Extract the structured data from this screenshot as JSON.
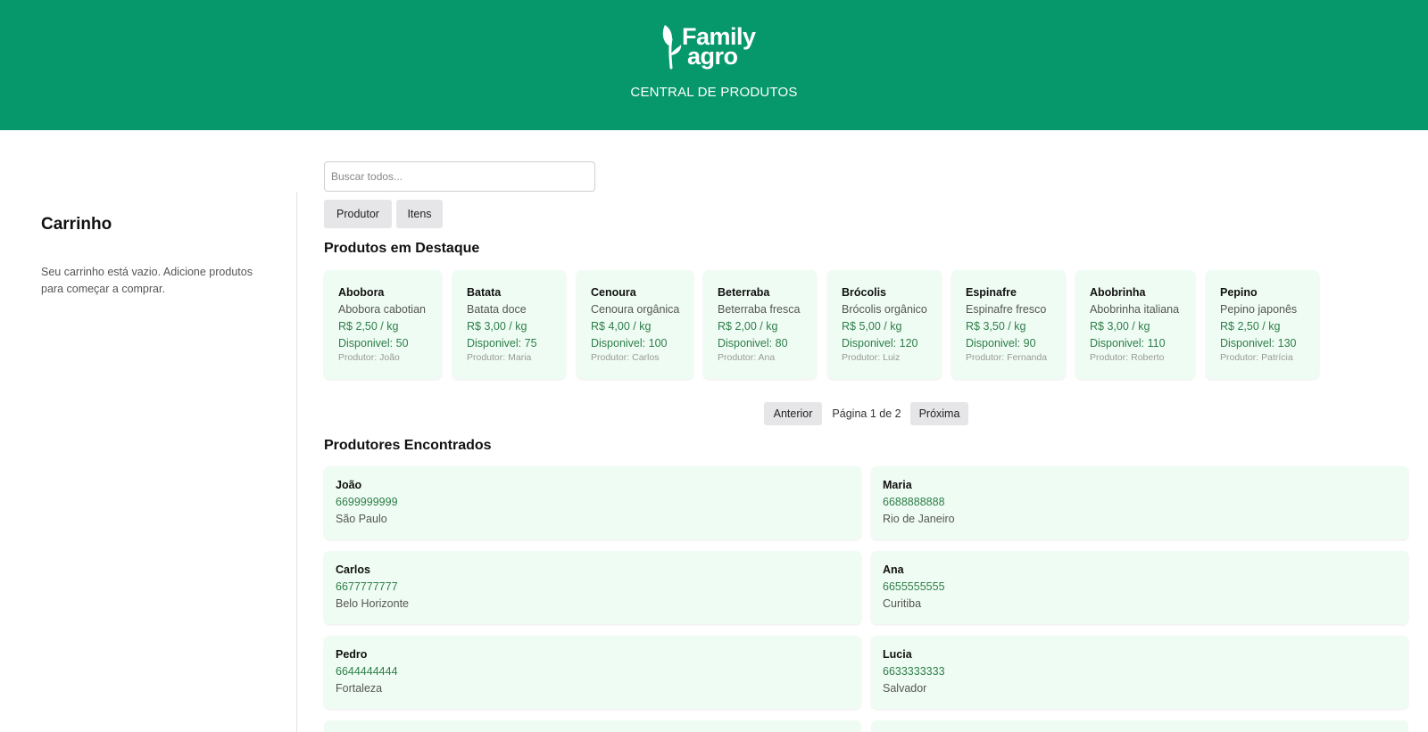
{
  "header": {
    "logo_line1": "Family",
    "logo_line2": "agro",
    "subtitle": "CENTRAL DE PRODUTOS",
    "brand_color": "#06986a"
  },
  "cart": {
    "title": "Carrinho",
    "empty_message": "Seu carrinho está vazio. Adicione produtos para começar a comprar."
  },
  "search": {
    "placeholder": "Buscar todos...",
    "value": ""
  },
  "filters": {
    "produtor": "Produtor",
    "itens": "Itens"
  },
  "featured": {
    "title": "Produtos em Destaque",
    "products": [
      {
        "name": "Abobora",
        "desc": "Abobora cabotian",
        "price": "R$ 2,50 /  kg",
        "stock": "Disponivel: 50",
        "producer": "Produtor: João"
      },
      {
        "name": "Batata",
        "desc": "Batata doce",
        "price": "R$ 3,00 /  kg",
        "stock": "Disponivel: 75",
        "producer": "Produtor: Maria"
      },
      {
        "name": "Cenoura",
        "desc": "Cenoura orgânica",
        "price": "R$ 4,00 /  kg",
        "stock": "Disponivel: 100",
        "producer": "Produtor: Carlos"
      },
      {
        "name": "Beterraba",
        "desc": "Beterraba fresca",
        "price": "R$ 2,00 /  kg",
        "stock": "Disponivel: 80",
        "producer": "Produtor: Ana"
      },
      {
        "name": "Brócolis",
        "desc": "Brócolis orgânico",
        "price": "R$ 5,00 /  kg",
        "stock": "Disponivel: 120",
        "producer": "Produtor: Luiz"
      },
      {
        "name": "Espinafre",
        "desc": "Espinafre fresco",
        "price": "R$ 3,50 /  kg",
        "stock": "Disponivel: 90",
        "producer": "Produtor: Fernanda"
      },
      {
        "name": "Abobrinha",
        "desc": "Abobrinha italiana",
        "price": "R$ 3,00 /  kg",
        "stock": "Disponivel: 110",
        "producer": "Produtor: Roberto"
      },
      {
        "name": "Pepino",
        "desc": "Pepino japonês",
        "price": "R$ 2,50 /  kg",
        "stock": "Disponivel: 130",
        "producer": "Produtor: Patrícia"
      }
    ]
  },
  "pagination": {
    "prev": "Anterior",
    "info": "Página 1 de 2",
    "next": "Próxima"
  },
  "producers": {
    "title": "Produtores Encontrados",
    "items": [
      {
        "name": "João",
        "phone": "6699999999",
        "city": "São Paulo"
      },
      {
        "name": "Maria",
        "phone": "6688888888",
        "city": "Rio de Janeiro"
      },
      {
        "name": "Carlos",
        "phone": "6677777777",
        "city": "Belo Horizonte"
      },
      {
        "name": "Ana",
        "phone": "6655555555",
        "city": "Curitiba"
      },
      {
        "name": "Pedro",
        "phone": "6644444444",
        "city": "Fortaleza"
      },
      {
        "name": "Lucia",
        "phone": "6633333333",
        "city": "Salvador"
      }
    ]
  }
}
